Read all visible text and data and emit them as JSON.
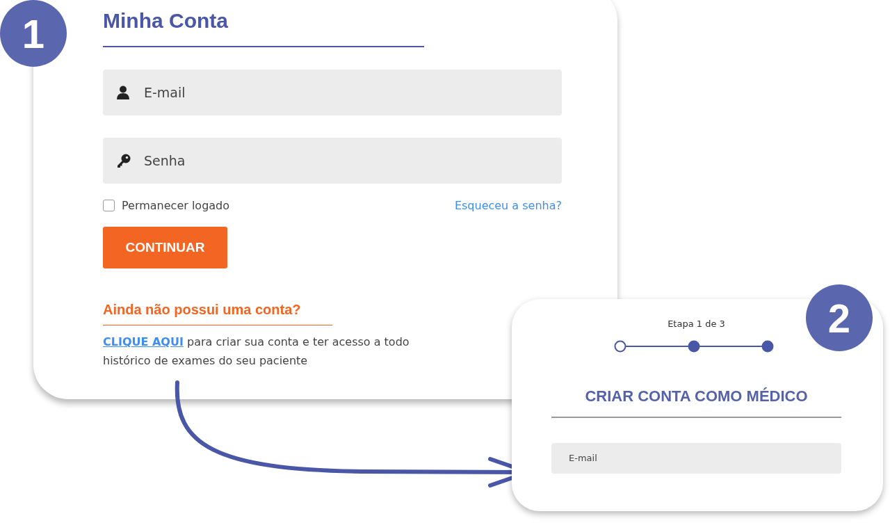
{
  "badges": [
    {
      "label": "1"
    },
    {
      "label": "2"
    }
  ],
  "login": {
    "title": "Minha Conta",
    "fields": [
      {
        "kind": "user",
        "placeholder": "E-mail"
      },
      {
        "kind": "key",
        "placeholder": "Senha"
      }
    ],
    "remember": {
      "label": "Permanecer logado",
      "checked": false
    },
    "forgot": "Esqueceu a senha?",
    "submit": "CONTINUAR",
    "signup_title": "Ainda não possui uma conta?",
    "signup_link": "CLIQUE AQUI",
    "signup_text": " para criar sua conta e ter acesso a todo histórico de exames do seu paciente"
  },
  "signup": {
    "step_label": "Etapa 1 de 3",
    "steps": [
      {
        "current": true
      },
      {
        "current": false
      },
      {
        "current": false
      }
    ],
    "title": "CRIAR CONTA COMO MÉDICO",
    "field": {
      "placeholder": "E-mail"
    }
  }
}
